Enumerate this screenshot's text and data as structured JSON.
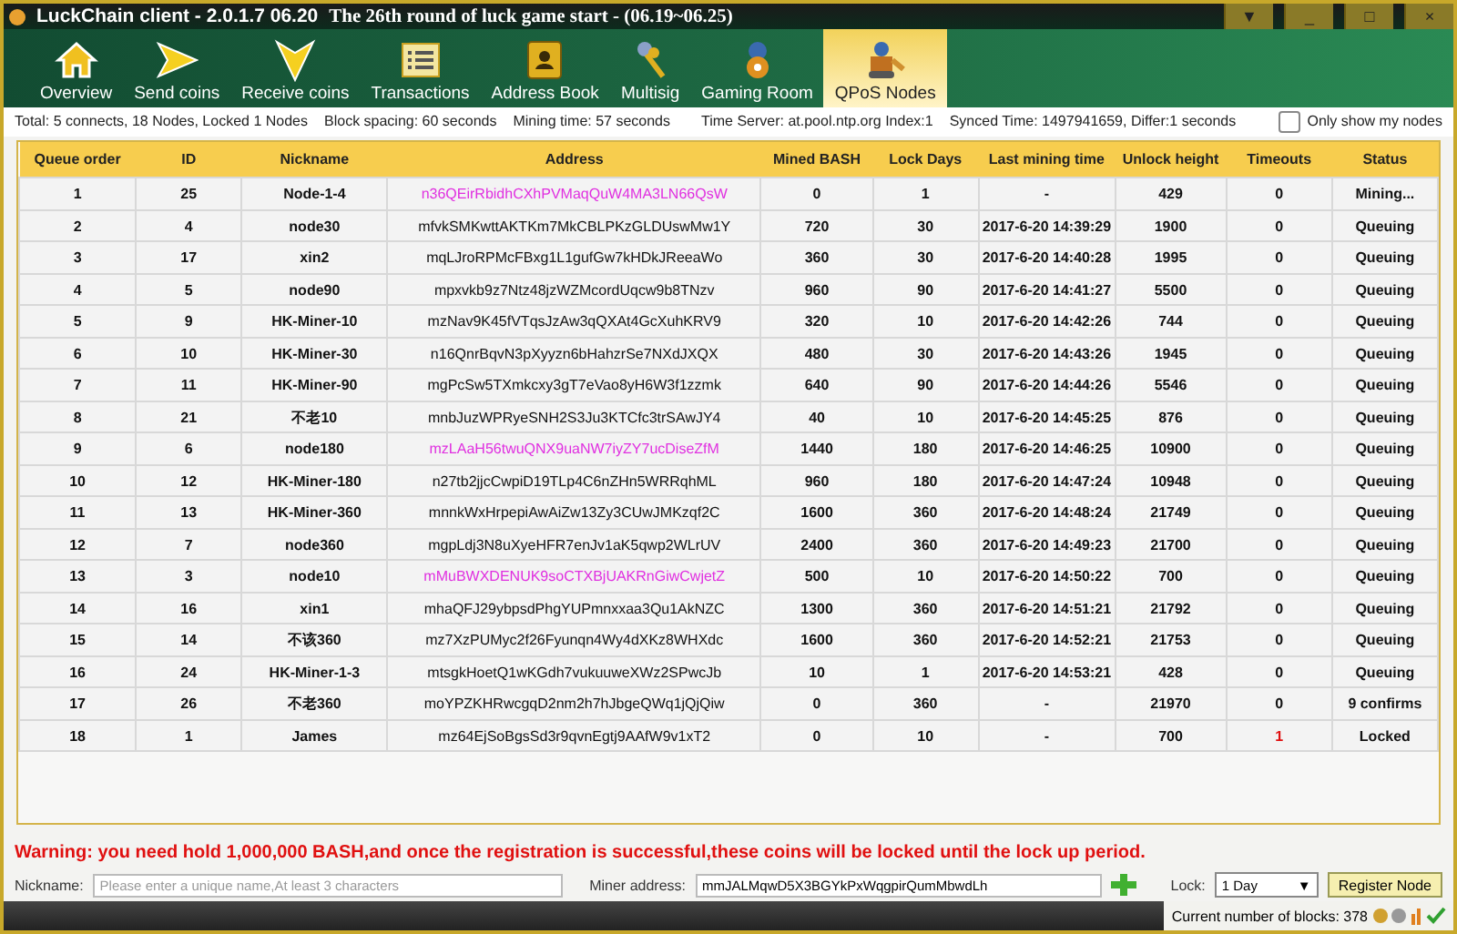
{
  "window": {
    "title": "LuckChain client - 2.0.1.7 06.20",
    "banner": "The 26th round of luck game start - (06.19~06.25)",
    "controls": [
      "▼",
      "_",
      "□",
      "×"
    ]
  },
  "tabs": [
    {
      "label": "Overview",
      "selected": false
    },
    {
      "label": "Send coins",
      "selected": false
    },
    {
      "label": "Receive coins",
      "selected": false
    },
    {
      "label": "Transactions",
      "selected": false
    },
    {
      "label": "Address Book",
      "selected": false
    },
    {
      "label": "Multisig",
      "selected": false
    },
    {
      "label": "Gaming Room",
      "selected": false
    },
    {
      "label": "QPoS Nodes",
      "selected": true
    }
  ],
  "info_bar": {
    "total": "Total: 5 connects, 18 Nodes, Locked 1 Nodes",
    "block_spacing": "Block spacing: 60 seconds",
    "mining_time": "Mining time: 57 seconds",
    "time_server": "Time Server: at.pool.ntp.org Index:1",
    "synced_time": "Synced Time: 1497941659,  Differ:1 seconds",
    "only_mine": {
      "label": "Only show my nodes",
      "checked": false
    }
  },
  "table": {
    "columns": [
      "Queue order",
      "ID",
      "Nickname",
      "Address",
      "Mined BASH",
      "Lock Days",
      "Last mining time",
      "Unlock height",
      "Timeouts",
      "Status"
    ],
    "rows": [
      {
        "cells": [
          "1",
          "25",
          "Node-1-4",
          "n36QEirRbidhCXhPVMaqQuW4MA3LN66QsW",
          "0",
          "1",
          "-",
          "429",
          "0",
          "Mining..."
        ],
        "mine": true,
        "timeout_alert": false
      },
      {
        "cells": [
          "2",
          "4",
          "node30",
          "mfvkSMKwttAKTKm7MkCBLPKzGLDUswMw1Y",
          "720",
          "30",
          "2017-6-20 14:39:29",
          "1900",
          "0",
          "Queuing"
        ],
        "mine": false,
        "timeout_alert": false
      },
      {
        "cells": [
          "3",
          "17",
          "xin2",
          "mqLJroRPMcFBxg1L1gufGw7kHDkJReeaWo",
          "360",
          "30",
          "2017-6-20 14:40:28",
          "1995",
          "0",
          "Queuing"
        ],
        "mine": false,
        "timeout_alert": false
      },
      {
        "cells": [
          "4",
          "5",
          "node90",
          "mpxvkb9z7Ntz48jzWZMcordUqcw9b8TNzv",
          "960",
          "90",
          "2017-6-20 14:41:27",
          "5500",
          "0",
          "Queuing"
        ],
        "mine": false,
        "timeout_alert": false
      },
      {
        "cells": [
          "5",
          "9",
          "HK-Miner-10",
          "mzNav9K45fVTqsJzAw3qQXAt4GcXuhKRV9",
          "320",
          "10",
          "2017-6-20 14:42:26",
          "744",
          "0",
          "Queuing"
        ],
        "mine": false,
        "timeout_alert": false
      },
      {
        "cells": [
          "6",
          "10",
          "HK-Miner-30",
          "n16QnrBqvN3pXyyzn6bHahzrSe7NXdJXQX",
          "480",
          "30",
          "2017-6-20 14:43:26",
          "1945",
          "0",
          "Queuing"
        ],
        "mine": false,
        "timeout_alert": false
      },
      {
        "cells": [
          "7",
          "11",
          "HK-Miner-90",
          "mgPcSw5TXmkcxy3gT7eVao8yH6W3f1zzmk",
          "640",
          "90",
          "2017-6-20 14:44:26",
          "5546",
          "0",
          "Queuing"
        ],
        "mine": false,
        "timeout_alert": false
      },
      {
        "cells": [
          "8",
          "21",
          "不老10",
          "mnbJuzWPRyeSNH2S3Ju3KTCfc3trSAwJY4",
          "40",
          "10",
          "2017-6-20 14:45:25",
          "876",
          "0",
          "Queuing"
        ],
        "mine": false,
        "timeout_alert": false
      },
      {
        "cells": [
          "9",
          "6",
          "node180",
          "mzLAaH56twuQNX9uaNW7iyZY7ucDiseZfM",
          "1440",
          "180",
          "2017-6-20 14:46:25",
          "10900",
          "0",
          "Queuing"
        ],
        "mine": true,
        "timeout_alert": false
      },
      {
        "cells": [
          "10",
          "12",
          "HK-Miner-180",
          "n27tb2jjcCwpiD19TLp4C6nZHn5WRRqhML",
          "960",
          "180",
          "2017-6-20 14:47:24",
          "10948",
          "0",
          "Queuing"
        ],
        "mine": false,
        "timeout_alert": false
      },
      {
        "cells": [
          "11",
          "13",
          "HK-Miner-360",
          "mnnkWxHrpepiAwAiZw13Zy3CUwJMKzqf2C",
          "1600",
          "360",
          "2017-6-20 14:48:24",
          "21749",
          "0",
          "Queuing"
        ],
        "mine": false,
        "timeout_alert": false
      },
      {
        "cells": [
          "12",
          "7",
          "node360",
          "mgpLdj3N8uXyeHFR7enJv1aK5qwp2WLrUV",
          "2400",
          "360",
          "2017-6-20 14:49:23",
          "21700",
          "0",
          "Queuing"
        ],
        "mine": false,
        "timeout_alert": false
      },
      {
        "cells": [
          "13",
          "3",
          "node10",
          "mMuBWXDENUK9soCTXBjUAKRnGiwCwjetZ",
          "500",
          "10",
          "2017-6-20 14:50:22",
          "700",
          "0",
          "Queuing"
        ],
        "mine": true,
        "timeout_alert": false
      },
      {
        "cells": [
          "14",
          "16",
          "xin1",
          "mhaQFJ29ybpsdPhgYUPmnxxaa3Qu1AkNZC",
          "1300",
          "360",
          "2017-6-20 14:51:21",
          "21792",
          "0",
          "Queuing"
        ],
        "mine": false,
        "timeout_alert": false
      },
      {
        "cells": [
          "15",
          "14",
          "不该360",
          "mz7XzPUMyc2f26Fyunqn4Wy4dXKz8WHXdc",
          "1600",
          "360",
          "2017-6-20 14:52:21",
          "21753",
          "0",
          "Queuing"
        ],
        "mine": false,
        "timeout_alert": false
      },
      {
        "cells": [
          "16",
          "24",
          "HK-Miner-1-3",
          "mtsgkHoetQ1wKGdh7vukuuweXWz2SPwcJb",
          "10",
          "1",
          "2017-6-20 14:53:21",
          "428",
          "0",
          "Queuing"
        ],
        "mine": false,
        "timeout_alert": false
      },
      {
        "cells": [
          "17",
          "26",
          "不老360",
          "moYPZKHRwcgqD2nm2h7hJbgeQWq1jQjQiw",
          "0",
          "360",
          "-",
          "21970",
          "0",
          "9 confirms"
        ],
        "mine": false,
        "timeout_alert": false
      },
      {
        "cells": [
          "18",
          "1",
          "James",
          "mz64EjSoBgsSd3r9qvnEgtj9AAfW9v1xT2",
          "0",
          "10",
          "-",
          "700",
          "1",
          "Locked"
        ],
        "mine": false,
        "timeout_alert": true
      }
    ]
  },
  "warning": "Warning: you need hold 1,000,000 BASH,and once the registration is successful,these coins will be locked until the lock up period.",
  "form": {
    "nickname_label": "Nickname:",
    "nickname_placeholder": "Please enter a unique name,At least 3 characters",
    "miner_label": "Miner address:",
    "miner_value": "mmJALMqwD5X3BGYkPxWqgpirQumMbwdLh",
    "lock_label": "Lock:",
    "lock_value": "1 Day",
    "lock_arrow": "▼",
    "register": "Register Node"
  },
  "status_bar": {
    "blocks": "Current number of blocks: 378"
  }
}
